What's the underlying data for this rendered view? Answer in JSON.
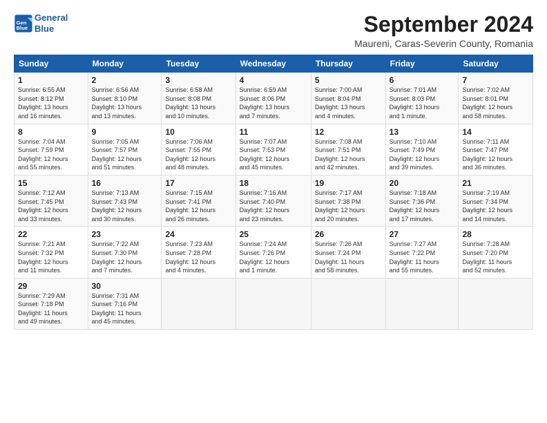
{
  "header": {
    "logo_line1": "General",
    "logo_line2": "Blue",
    "month": "September 2024",
    "location": "Maureni, Caras-Severin County, Romania"
  },
  "weekdays": [
    "Sunday",
    "Monday",
    "Tuesday",
    "Wednesday",
    "Thursday",
    "Friday",
    "Saturday"
  ],
  "weeks": [
    [
      {
        "day": "1",
        "info": "Sunrise: 6:55 AM\nSunset: 8:12 PM\nDaylight: 13 hours\nand 16 minutes."
      },
      {
        "day": "2",
        "info": "Sunrise: 6:56 AM\nSunset: 8:10 PM\nDaylight: 13 hours\nand 13 minutes."
      },
      {
        "day": "3",
        "info": "Sunrise: 6:58 AM\nSunset: 8:08 PM\nDaylight: 13 hours\nand 10 minutes."
      },
      {
        "day": "4",
        "info": "Sunrise: 6:59 AM\nSunset: 8:06 PM\nDaylight: 13 hours\nand 7 minutes."
      },
      {
        "day": "5",
        "info": "Sunrise: 7:00 AM\nSunset: 8:04 PM\nDaylight: 13 hours\nand 4 minutes."
      },
      {
        "day": "6",
        "info": "Sunrise: 7:01 AM\nSunset: 8:03 PM\nDaylight: 13 hours\nand 1 minute."
      },
      {
        "day": "7",
        "info": "Sunrise: 7:02 AM\nSunset: 8:01 PM\nDaylight: 12 hours\nand 58 minutes."
      }
    ],
    [
      {
        "day": "8",
        "info": "Sunrise: 7:04 AM\nSunset: 7:59 PM\nDaylight: 12 hours\nand 55 minutes."
      },
      {
        "day": "9",
        "info": "Sunrise: 7:05 AM\nSunset: 7:57 PM\nDaylight: 12 hours\nand 51 minutes."
      },
      {
        "day": "10",
        "info": "Sunrise: 7:06 AM\nSunset: 7:55 PM\nDaylight: 12 hours\nand 48 minutes."
      },
      {
        "day": "11",
        "info": "Sunrise: 7:07 AM\nSunset: 7:53 PM\nDaylight: 12 hours\nand 45 minutes."
      },
      {
        "day": "12",
        "info": "Sunrise: 7:08 AM\nSunset: 7:51 PM\nDaylight: 12 hours\nand 42 minutes."
      },
      {
        "day": "13",
        "info": "Sunrise: 7:10 AM\nSunset: 7:49 PM\nDaylight: 12 hours\nand 39 minutes."
      },
      {
        "day": "14",
        "info": "Sunrise: 7:11 AM\nSunset: 7:47 PM\nDaylight: 12 hours\nand 36 minutes."
      }
    ],
    [
      {
        "day": "15",
        "info": "Sunrise: 7:12 AM\nSunset: 7:45 PM\nDaylight: 12 hours\nand 33 minutes."
      },
      {
        "day": "16",
        "info": "Sunrise: 7:13 AM\nSunset: 7:43 PM\nDaylight: 12 hours\nand 30 minutes."
      },
      {
        "day": "17",
        "info": "Sunrise: 7:15 AM\nSunset: 7:41 PM\nDaylight: 12 hours\nand 26 minutes."
      },
      {
        "day": "18",
        "info": "Sunrise: 7:16 AM\nSunset: 7:40 PM\nDaylight: 12 hours\nand 23 minutes."
      },
      {
        "day": "19",
        "info": "Sunrise: 7:17 AM\nSunset: 7:38 PM\nDaylight: 12 hours\nand 20 minutes."
      },
      {
        "day": "20",
        "info": "Sunrise: 7:18 AM\nSunset: 7:36 PM\nDaylight: 12 hours\nand 17 minutes."
      },
      {
        "day": "21",
        "info": "Sunrise: 7:19 AM\nSunset: 7:34 PM\nDaylight: 12 hours\nand 14 minutes."
      }
    ],
    [
      {
        "day": "22",
        "info": "Sunrise: 7:21 AM\nSunset: 7:32 PM\nDaylight: 12 hours\nand 11 minutes."
      },
      {
        "day": "23",
        "info": "Sunrise: 7:22 AM\nSunset: 7:30 PM\nDaylight: 12 hours\nand 7 minutes."
      },
      {
        "day": "24",
        "info": "Sunrise: 7:23 AM\nSunset: 7:28 PM\nDaylight: 12 hours\nand 4 minutes."
      },
      {
        "day": "25",
        "info": "Sunrise: 7:24 AM\nSunset: 7:26 PM\nDaylight: 12 hours\nand 1 minute."
      },
      {
        "day": "26",
        "info": "Sunrise: 7:26 AM\nSunset: 7:24 PM\nDaylight: 11 hours\nand 58 minutes."
      },
      {
        "day": "27",
        "info": "Sunrise: 7:27 AM\nSunset: 7:22 PM\nDaylight: 11 hours\nand 55 minutes."
      },
      {
        "day": "28",
        "info": "Sunrise: 7:28 AM\nSunset: 7:20 PM\nDaylight: 11 hours\nand 52 minutes."
      }
    ],
    [
      {
        "day": "29",
        "info": "Sunrise: 7:29 AM\nSunset: 7:18 PM\nDaylight: 11 hours\nand 49 minutes."
      },
      {
        "day": "30",
        "info": "Sunrise: 7:31 AM\nSunset: 7:16 PM\nDaylight: 11 hours\nand 45 minutes."
      },
      {
        "day": "",
        "info": ""
      },
      {
        "day": "",
        "info": ""
      },
      {
        "day": "",
        "info": ""
      },
      {
        "day": "",
        "info": ""
      },
      {
        "day": "",
        "info": ""
      }
    ]
  ]
}
